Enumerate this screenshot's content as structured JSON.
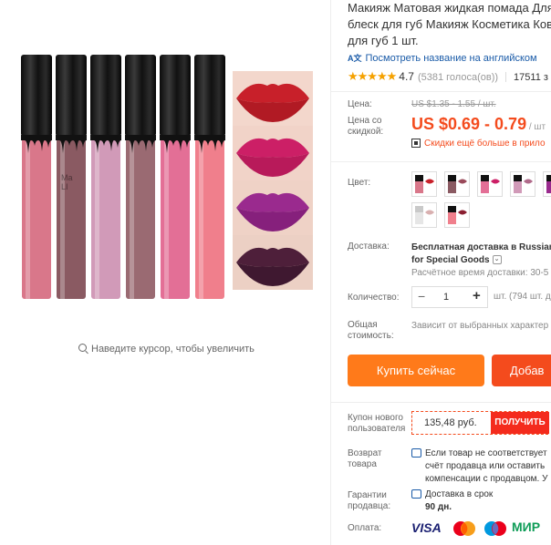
{
  "product": {
    "title_lines": [
      "Макияж Матовая жидкая помада Для",
      "блеск для губ Макияж Косметика Ковр",
      "для губ 1 шт."
    ],
    "translate_link": "Посмотреть название на английском",
    "translate_badge": "A文",
    "rating_stars": "★★★★★",
    "rating": "4.7",
    "votes": "(5381 голоса(ов))",
    "orders": "17511 з"
  },
  "gallery": {
    "zoom_hint": "Наведите курсор, чтобы увеличить",
    "tube_labels": [
      "",
      "Ma LI",
      "",
      "",
      "",
      ""
    ],
    "tube_colors": [
      "#d9778a",
      "#8a5a62",
      "#d19ab8",
      "#9a6a72",
      "#e36f96",
      "#f07f8c"
    ],
    "lip_colors": [
      "#c8202a",
      "#cc1f66",
      "#9a2a8e",
      "#4e1f3a"
    ]
  },
  "price": {
    "label": "Цена:",
    "old": "US $1.35 - 1.55 / шт.",
    "discount_label_1": "Цена со",
    "discount_label_2": "скидкой:",
    "new": "US $0.69 - 0.79",
    "per": " / шт",
    "app_promo": "Скидки ещё больше в прило"
  },
  "color": {
    "label": "Цвет:"
  },
  "shipping": {
    "label": "Доставка:",
    "line1": "Бесплатная доставка в Russian",
    "line2": "for Special Goods",
    "eta": "Расчётное время доставки: 30-5"
  },
  "quantity": {
    "label": "Количество:",
    "minus": "−",
    "value": "1",
    "plus": "+",
    "info": "шт. (794 шт. д"
  },
  "total": {
    "label_1": "Общая",
    "label_2": "стоимость:",
    "value": "Зависит от выбранных характер"
  },
  "actions": {
    "buy": "Купить сейчас",
    "add": "Добав"
  },
  "coupon": {
    "label_1": "Купон нового",
    "label_2": "пользователя",
    "amount": "135,48 руб.",
    "get": "ПОЛУЧИТЬ"
  },
  "returns": {
    "label_1": "Возврат",
    "label_2": "товара",
    "line1": "Если товар не соответствует",
    "line2": "счёт продавца или оставить",
    "line3": "компенсации с продавцом. У"
  },
  "guarantee": {
    "label_1": "Гарантии",
    "label_2": "продавца:",
    "line1": "Доставка в срок",
    "line2": "90 дн."
  },
  "payment": {
    "label": "Оплата:",
    "visa": "VISA",
    "mastercard": "MasterCard",
    "maestro": "Maestro",
    "mir": "МИР"
  },
  "colors": {
    "accent": "#f44b1d",
    "buy": "#ff7a1a",
    "link": "#1a5ba8",
    "star": "#f5a100"
  }
}
